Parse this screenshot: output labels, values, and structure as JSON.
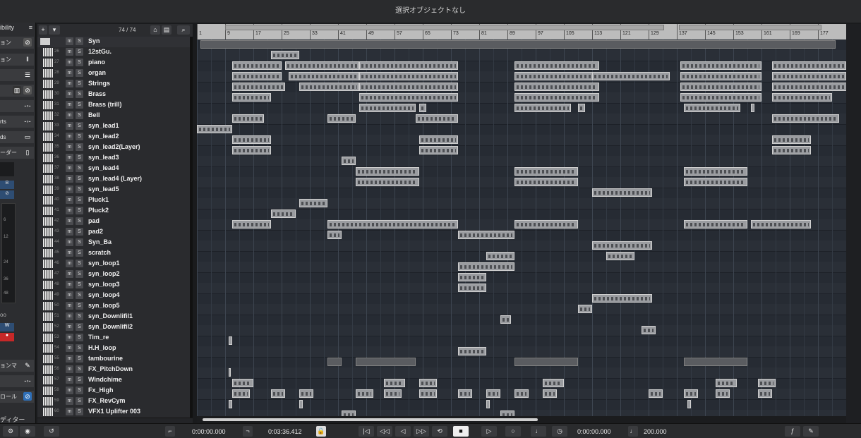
{
  "window": {
    "title": "選択オブジェクトなし"
  },
  "inspector": {
    "header": "ibility",
    "rows": [
      "ョン",
      "",
      "",
      "",
      "rts",
      "ds",
      "ーダー"
    ],
    "meter_ticks": [
      "6",
      "12",
      "24",
      "36",
      "48"
    ],
    "readout": "oo",
    "buttons": [
      "W",
      "R"
    ],
    "lower_rows": [
      "ョンマ",
      "",
      "ロール"
    ],
    "footer": "ディター"
  },
  "track_list": {
    "count": "74 / 74",
    "tracks": [
      {
        "num": "",
        "name": "Syn",
        "folder": true
      },
      {
        "num": "26",
        "name": "12stGu."
      },
      {
        "num": "27",
        "name": "piano"
      },
      {
        "num": "28",
        "name": "organ"
      },
      {
        "num": "29",
        "name": "Strings"
      },
      {
        "num": "30",
        "name": "Brass"
      },
      {
        "num": "31",
        "name": "Brass (trill)"
      },
      {
        "num": "32",
        "name": "Bell"
      },
      {
        "num": "33",
        "name": "syn_lead1"
      },
      {
        "num": "34",
        "name": "syn_lead2"
      },
      {
        "num": "35",
        "name": "syn_lead2(Layer)"
      },
      {
        "num": "36",
        "name": "syn_lead3"
      },
      {
        "num": "37",
        "name": "syn_lead4"
      },
      {
        "num": "38",
        "name": "syn_lead4 (Layer)"
      },
      {
        "num": "39",
        "name": "syn_lead5"
      },
      {
        "num": "40",
        "name": "Pluck1"
      },
      {
        "num": "41",
        "name": "Pluck2"
      },
      {
        "num": "42",
        "name": "pad"
      },
      {
        "num": "43",
        "name": "pad2"
      },
      {
        "num": "44",
        "name": "Syn_Ba"
      },
      {
        "num": "45",
        "name": "scratch"
      },
      {
        "num": "46",
        "name": "syn_loop1"
      },
      {
        "num": "47",
        "name": "syn_loop2"
      },
      {
        "num": "48",
        "name": "syn_loop3"
      },
      {
        "num": "49",
        "name": "syn_loop4"
      },
      {
        "num": "50",
        "name": "syn_loop5"
      },
      {
        "num": "51",
        "name": "syn_Downlifil1"
      },
      {
        "num": "52",
        "name": "syn_Downlifil2"
      },
      {
        "num": "53",
        "name": "Tim_re"
      },
      {
        "num": "54",
        "name": "H.H_loop"
      },
      {
        "num": "55",
        "name": "tambourine"
      },
      {
        "num": "56",
        "name": "FX_PitchDown"
      },
      {
        "num": "57",
        "name": "Windchime"
      },
      {
        "num": "58",
        "name": "Fx_High"
      },
      {
        "num": "59",
        "name": "FX_RevCym"
      },
      {
        "num": "60",
        "name": "VFX1 Uplifter 003"
      }
    ]
  },
  "ruler": {
    "labels": [
      "1",
      "9",
      "17",
      "25",
      "33",
      "41",
      "49",
      "57",
      "65",
      "73",
      "81",
      "89",
      "97",
      "105",
      "113",
      "121",
      "129",
      "137",
      "145",
      "153",
      "161",
      "169",
      "177"
    ]
  },
  "transport": {
    "left_locator": "0:00:00.000",
    "right_locator": "0:03:36.412",
    "position": "0:00:00.000",
    "tempo": "200.000"
  }
}
